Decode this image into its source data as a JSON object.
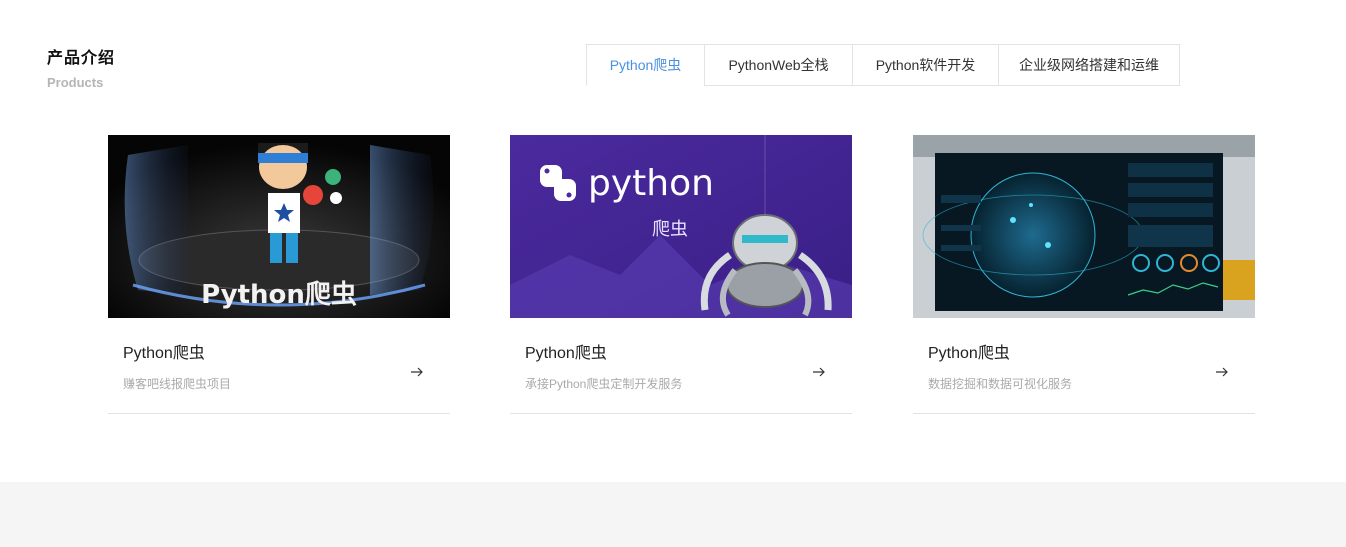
{
  "section": {
    "title": "产品介绍",
    "subtitle": "Products"
  },
  "tabs": [
    {
      "label": "Python爬虫",
      "active": true
    },
    {
      "label": "PythonWeb全栈",
      "active": false
    },
    {
      "label": "Python软件开发",
      "active": false
    },
    {
      "label": "企业级网络搭建和运维",
      "active": false
    }
  ],
  "cards": [
    {
      "title": "Python爬虫",
      "desc": "赚客吧线报爬虫项目",
      "image_caption": "Python爬虫"
    },
    {
      "title": "Python爬虫",
      "desc": "承接Python爬虫定制开发服务",
      "image_logo_text": "python",
      "image_caption": "爬虫"
    },
    {
      "title": "Python爬虫",
      "desc": "数据挖掘和数据可视化服务"
    }
  ],
  "colors": {
    "accent": "#4a90e2",
    "border": "#e3e3e3",
    "muted": "#aaaaaa",
    "footer_bg": "#f5f5f5"
  },
  "icons": {
    "card_arrow": "arrow-right-icon"
  }
}
